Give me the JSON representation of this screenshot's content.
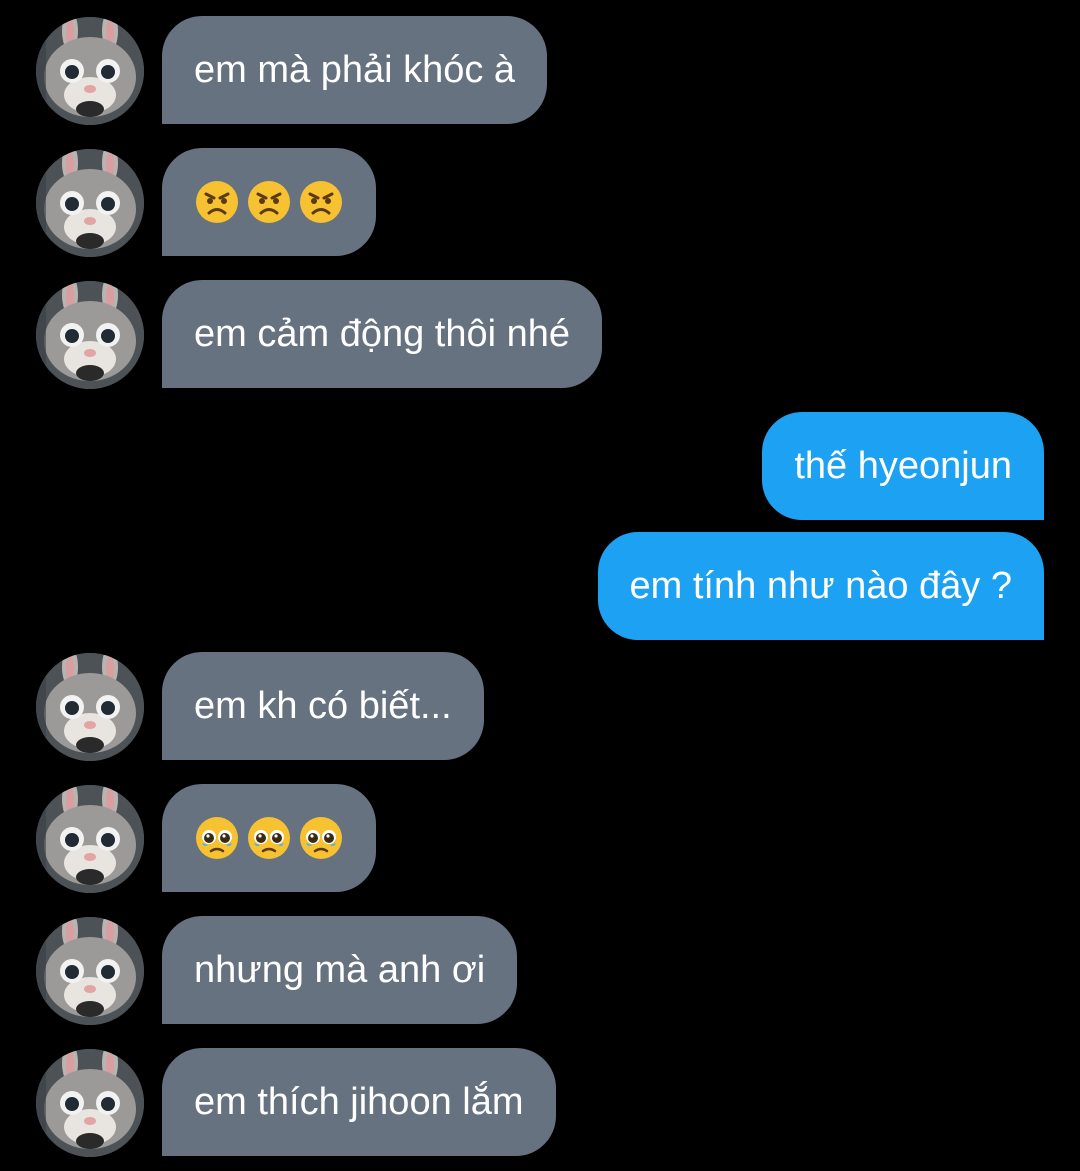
{
  "conversation": {
    "messages": [
      {
        "direction": "in",
        "text": "em mà phải khóc à"
      },
      {
        "direction": "in",
        "emoji": [
          "angry-face",
          "angry-face",
          "angry-face"
        ]
      },
      {
        "direction": "in",
        "text": "em cảm động thôi nhé"
      },
      {
        "direction": "out",
        "text": "thế hyeonjun"
      },
      {
        "direction": "out",
        "text": "em tính như nào đây ?"
      },
      {
        "direction": "in",
        "text": "em kh có biết..."
      },
      {
        "direction": "in",
        "emoji": [
          "pleading-face",
          "pleading-face",
          "pleading-face"
        ]
      },
      {
        "direction": "in",
        "text": "nhưng mà anh ơi"
      },
      {
        "direction": "in",
        "text": "em thích jihoon lắm"
      }
    ]
  },
  "colors": {
    "background": "#000000",
    "incoming_bubble": "#66727f",
    "outgoing_bubble": "#1da1f2",
    "text": "#ffffff"
  },
  "icons": {
    "avatar": "bunny-mascot-avatar"
  }
}
